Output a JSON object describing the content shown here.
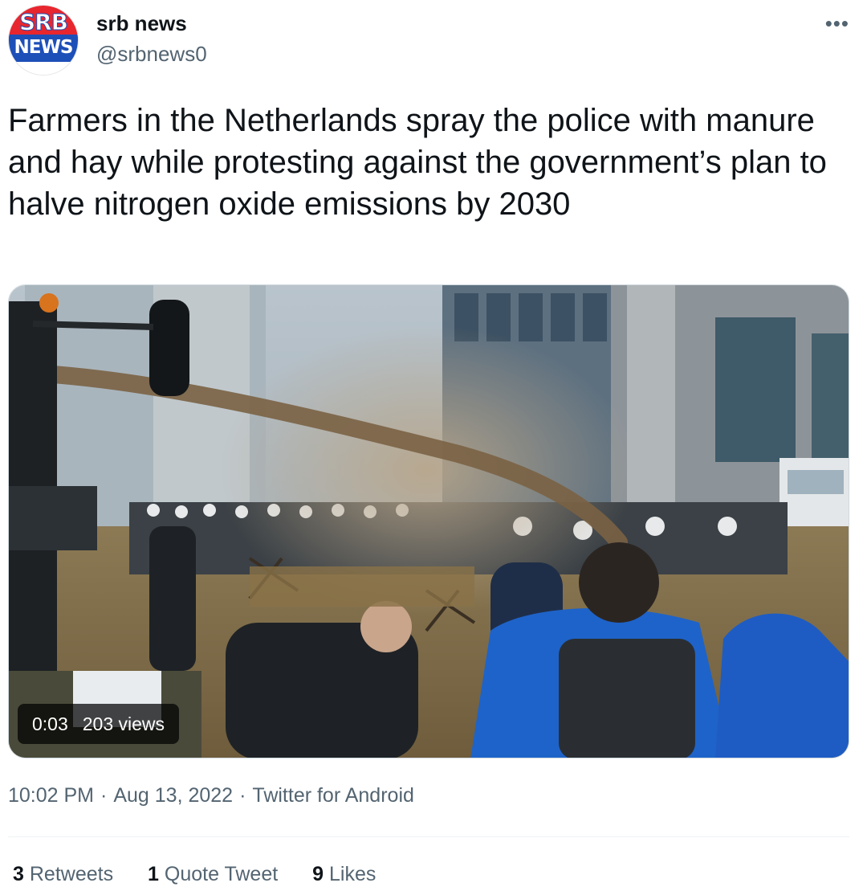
{
  "author": {
    "display_name": "srb news",
    "handle": "@srbnews0",
    "avatar_text_top": "SRB",
    "avatar_text_bottom": "NEWS",
    "more_icon": "ellipsis-icon"
  },
  "tweet": {
    "text": "Farmers in the Netherlands spray the police with manure and hay while protesting against the government’s plan to halve nitrogen oxide emissions by 2030"
  },
  "media": {
    "type": "video",
    "duration": "0:03",
    "views": "203 views"
  },
  "meta": {
    "time": "10:02 PM",
    "date": "Aug 13, 2022",
    "source": "Twitter for Android",
    "separator": "·"
  },
  "stats": {
    "retweets_count": "3",
    "retweets_label": "Retweets",
    "quotes_count": "1",
    "quotes_label": "Quote Tweet",
    "likes_count": "9",
    "likes_label": "Likes"
  },
  "colors": {
    "text_primary": "#0f1419",
    "text_secondary": "#536471",
    "border": "#cfd9de",
    "avatar_red": "#e8262e",
    "avatar_blue": "#1d4fb8"
  }
}
